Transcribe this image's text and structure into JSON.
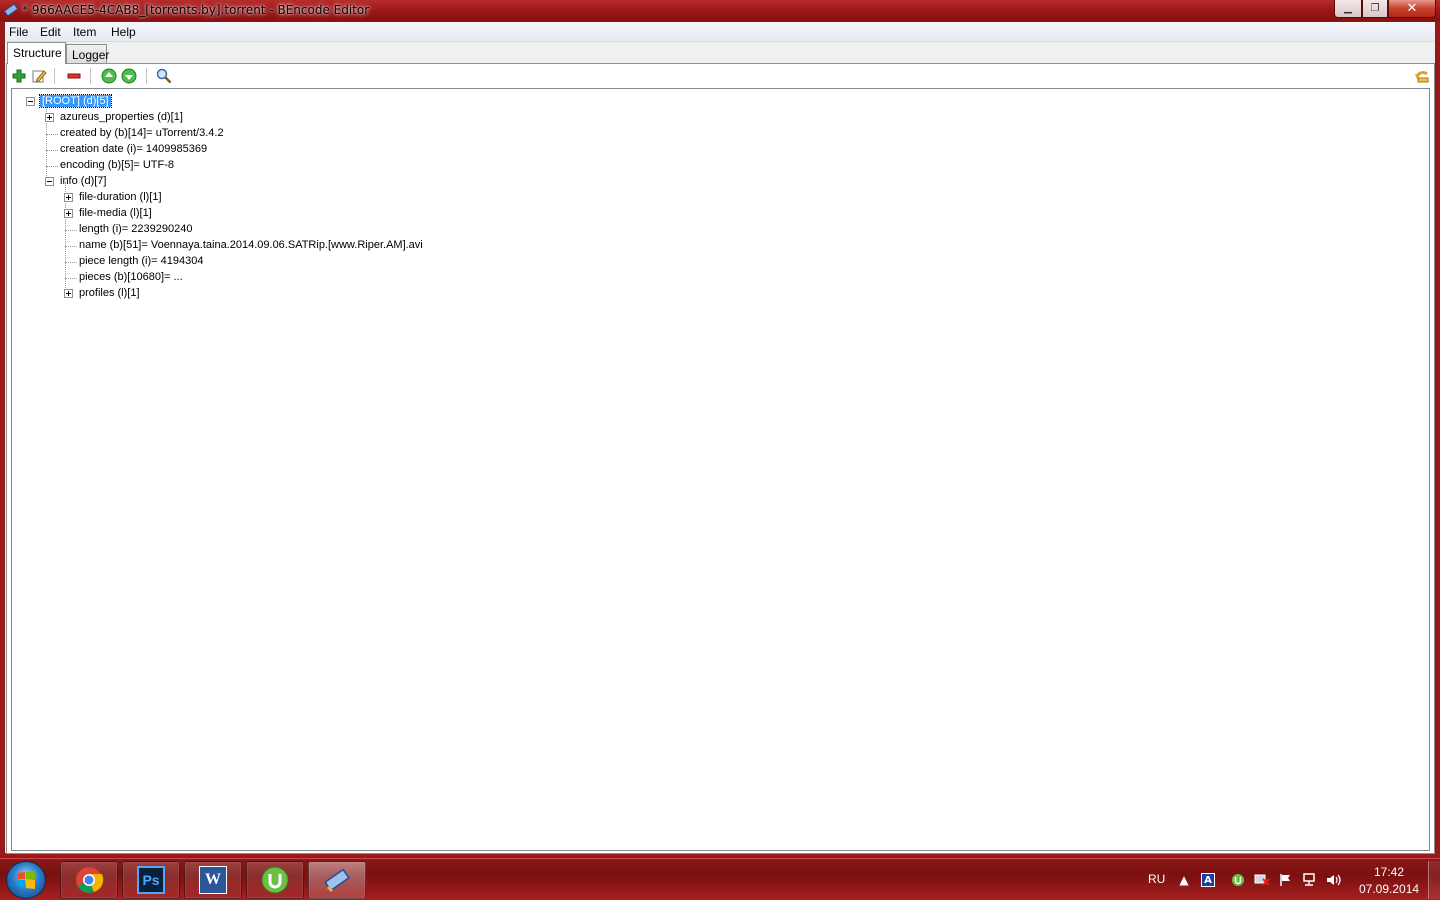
{
  "window": {
    "title": "* 966AACE5-4CAB8_[torrents.by].torrent - BEncode Editor",
    "close_glyph": "✕",
    "min_glyph": "▁",
    "max_glyph": "❐"
  },
  "menu": {
    "file": "File",
    "edit": "Edit",
    "item": "Item",
    "help": "Help"
  },
  "tabs": {
    "structure": "Structure",
    "logger": "Logger"
  },
  "toolbar": {
    "icons": [
      "add-icon",
      "edit-icon",
      "remove-icon",
      "move-up-icon",
      "move-down-icon",
      "search-icon",
      "undo-icon"
    ]
  },
  "tree": {
    "root": "[ROOT] (d)[5]",
    "azureus": "azureus_properties (d)[1]",
    "created_by": "created by (b)[14]= uTorrent/3.4.2",
    "creation_date": "creation date (i)= 1409985369",
    "encoding": "encoding (b)[5]= UTF-8",
    "info": "info (d)[7]",
    "file_duration": "file-duration (l)[1]",
    "file_media": "file-media (l)[1]",
    "length": "length (i)= 2239290240",
    "name": "name (b)[51]= Voennaya.taina.2014.09.06.SATRip.[www.Riper.AM].avi",
    "piece_length": "piece length (i)= 4194304",
    "pieces": "pieces (b)[10680]= ...",
    "profiles": "profiles (l)[1]"
  },
  "taskbar": {
    "apps": [
      "chrome-icon",
      "photoshop-icon",
      "word-icon",
      "utorrent-icon",
      "bencode-editor-icon"
    ],
    "photoshop_label": "Ps",
    "word_label": "W",
    "lang": "RU",
    "time": "17:42",
    "date": "07.09.2014",
    "tray_a": "A"
  },
  "colors": {
    "titlebar": "#9a1616",
    "selection": "#3399ff",
    "taskbar": "#8a1818"
  }
}
